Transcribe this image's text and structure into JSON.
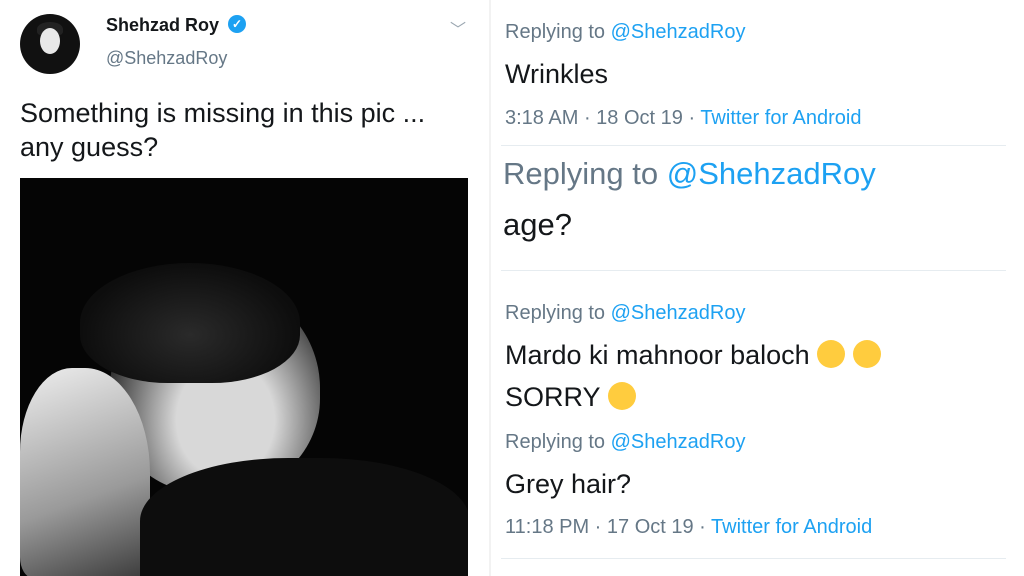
{
  "tweet": {
    "name": "Shehzad Roy",
    "handle": "@ShehzadRoy",
    "text_line1": "Something is missing in this pic ...",
    "text_line2": "any guess?",
    "icons": {
      "verified": "verified-badge-icon",
      "more": "chevron-down-icon"
    }
  },
  "replies": [
    {
      "replying_label": "Replying to",
      "mention": "@ShehzadRoy",
      "text": "Wrinkles",
      "time": "3:18 AM",
      "date": "18 Oct 19",
      "source": "Twitter for Android"
    },
    {
      "replying_label": "Replying to",
      "mention": "@ShehzadRoy",
      "text": "age?"
    },
    {
      "replying_label": "Replying to",
      "mention": "@ShehzadRoy",
      "text_line1": "Mardo ki mahnoor baloch",
      "text_line2": "SORRY",
      "emojis": [
        "face-with-rolling-eyes",
        "expressionless-face",
        "face-with-tears-of-joy"
      ]
    },
    {
      "replying_label": "Replying to",
      "mention": "@ShehzadRoy",
      "text": "Grey hair?",
      "time": "11:18 PM",
      "date": "17 Oct 19",
      "source": "Twitter for Android"
    }
  ],
  "colors": {
    "link": "#1da1f2",
    "muted": "#657786",
    "text": "#14171a"
  }
}
